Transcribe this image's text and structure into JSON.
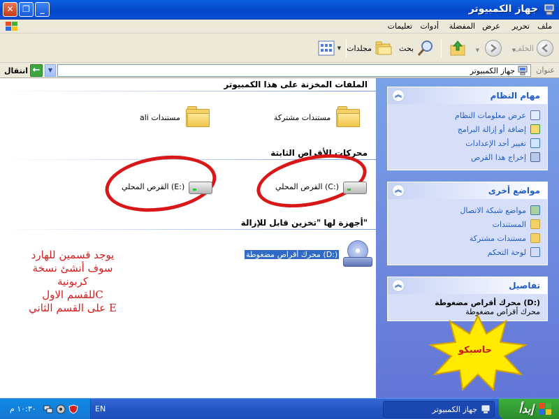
{
  "window": {
    "title": "جهاز الكمبيوتر",
    "controls": [
      "close",
      "maximize",
      "minimize"
    ]
  },
  "menu": [
    "ملف",
    "تحرير",
    "عرض",
    "المفضلة",
    "أدوات",
    "تعليمات"
  ],
  "toolbar": {
    "back": "الخلف",
    "search": "بحث",
    "folders": "مجلدات"
  },
  "address": {
    "label": "عنوان",
    "value": "جهاز الكمبيوتر",
    "go": "انتقال"
  },
  "groups": {
    "stored_files": "الملفات المخزنة على هذا الكمبيوتر",
    "hard_drives": "محركات الأقراص الثابتة",
    "removable": "أجهزة لها \"تخزين قابل للإزالة\""
  },
  "items": {
    "shared_docs": "مستندات مشتركة",
    "ali_docs": "ali مستندات",
    "drive_c": "القرص المحلي (C:)",
    "drive_e": "القرص المحلي (E:)",
    "drive_d": "محرك أقراص مضغوطة (D:)"
  },
  "note": [
    "يوجد قسمين للهارد",
    "سوف أنشئ نسخة كربونية",
    "للقسم الاولC",
    "على القسم الثاني E"
  ],
  "taskpane": {
    "system_tasks": {
      "title": "مهام النظام",
      "links": [
        "عرض معلومات النظام",
        "إضافة أو إزالة البرامج",
        "تغيير أحد الإعدادات",
        "إخراج هذا القرص"
      ]
    },
    "other_places": {
      "title": "مواضع أخرى",
      "links": [
        "مواضع شبكة الاتصال",
        "المستندات",
        "مستندات مشتركة",
        "لوحة التحكم"
      ]
    },
    "details": {
      "title": "تفاصيل",
      "name": "محرك أقراص مضغوطة (D:)",
      "type": "محرك أقراص مضغوطة"
    }
  },
  "stamp": "حاسبكو",
  "taskbar": {
    "start": "إبدأ",
    "task": "جهاز الكمبيوتر",
    "lang": "EN",
    "clock": "١٠:٣٠ م"
  },
  "colors": {
    "accent": "#215dc6",
    "annotation": "#d42020",
    "taskpane": "#7ba2e7"
  }
}
